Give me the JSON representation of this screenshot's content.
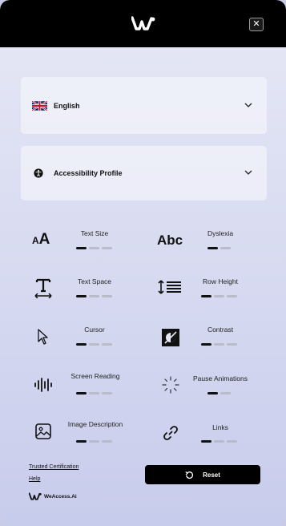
{
  "header": {
    "logo_icon": "weaccess-logo-icon",
    "close_label": "✕"
  },
  "language": {
    "flag_icon": "uk-flag-icon",
    "label": "English"
  },
  "profile": {
    "icon": "accessibility-person-icon",
    "label": "Accessibility Profile"
  },
  "features": [
    {
      "label": "Text Size",
      "icon": "text-size-icon",
      "glyph": "aA",
      "level": 1,
      "steps": 3
    },
    {
      "label": "Dyslexia",
      "icon": "dyslexia-font-icon",
      "glyph": "Abc",
      "level": 1,
      "steps": 2
    },
    {
      "label": "Text Space",
      "icon": "text-space-icon",
      "level": 1,
      "steps": 3
    },
    {
      "label": "Row Height",
      "icon": "row-height-icon",
      "level": 1,
      "steps": 3
    },
    {
      "label": "Cursor",
      "icon": "cursor-icon",
      "level": 1,
      "steps": 3
    },
    {
      "label": "Contrast",
      "icon": "contrast-icon",
      "level": 1,
      "steps": 3
    },
    {
      "label": "Screen Reading",
      "icon": "screen-reading-icon",
      "level": 1,
      "steps": 3
    },
    {
      "label": "Pause Animations",
      "icon": "pause-animations-icon",
      "level": 1,
      "steps": 2
    },
    {
      "label": "Image Description",
      "icon": "image-description-icon",
      "level": 1,
      "steps": 3
    },
    {
      "label": "Links",
      "icon": "links-icon",
      "level": 1,
      "steps": 3
    }
  ],
  "footer": {
    "trusted_label": "Trusted Certification",
    "help_label": "Help",
    "reset_label": "Reset",
    "brand_name": "WeAccess.Ai"
  }
}
